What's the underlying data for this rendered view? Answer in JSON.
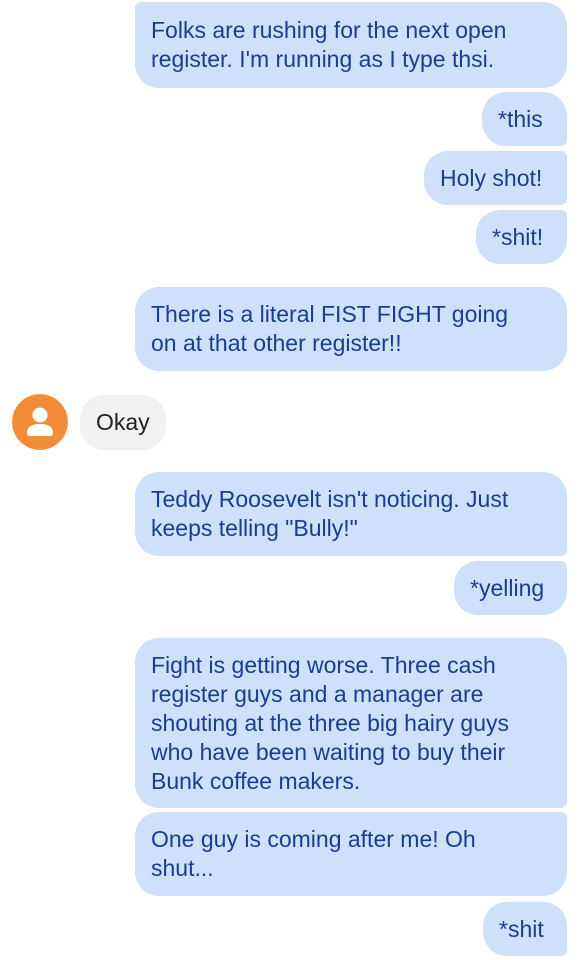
{
  "conversation": {
    "messages": [
      {
        "direction": "outgoing",
        "text": "Folks are rushing for the next open\nregister.  I'm running as I type thsi."
      },
      {
        "direction": "outgoing",
        "text": "*this"
      },
      {
        "direction": "outgoing",
        "text": "Holy shot!"
      },
      {
        "direction": "outgoing",
        "text": "*shit!"
      },
      {
        "direction": "outgoing",
        "text": "There is a literal FIST FIGHT going\non at that other register!!"
      },
      {
        "direction": "incoming",
        "text": "Okay"
      },
      {
        "direction": "outgoing",
        "text": "Teddy Roosevelt isn't noticing.  Just\nkeeps telling \"Bully!\""
      },
      {
        "direction": "outgoing",
        "text": "*yelling"
      },
      {
        "direction": "outgoing",
        "text": "Fight is getting worse.  Three cash\nregister guys and a manager are\nshouting at the three big hairy guys\nwho have been waiting to buy their\nBunk coffee makers."
      },
      {
        "direction": "outgoing",
        "text": "One guy is coming after me!  Oh\nshut..."
      },
      {
        "direction": "outgoing",
        "text": "*shit"
      }
    ]
  },
  "colors": {
    "outgoing_bubble": "#cfe0fb",
    "outgoing_text": "#1a3d8f",
    "incoming_bubble": "#f1f1f2",
    "incoming_text": "#222222",
    "avatar": "#f28c38"
  },
  "icons": {
    "avatar": "person-icon"
  }
}
